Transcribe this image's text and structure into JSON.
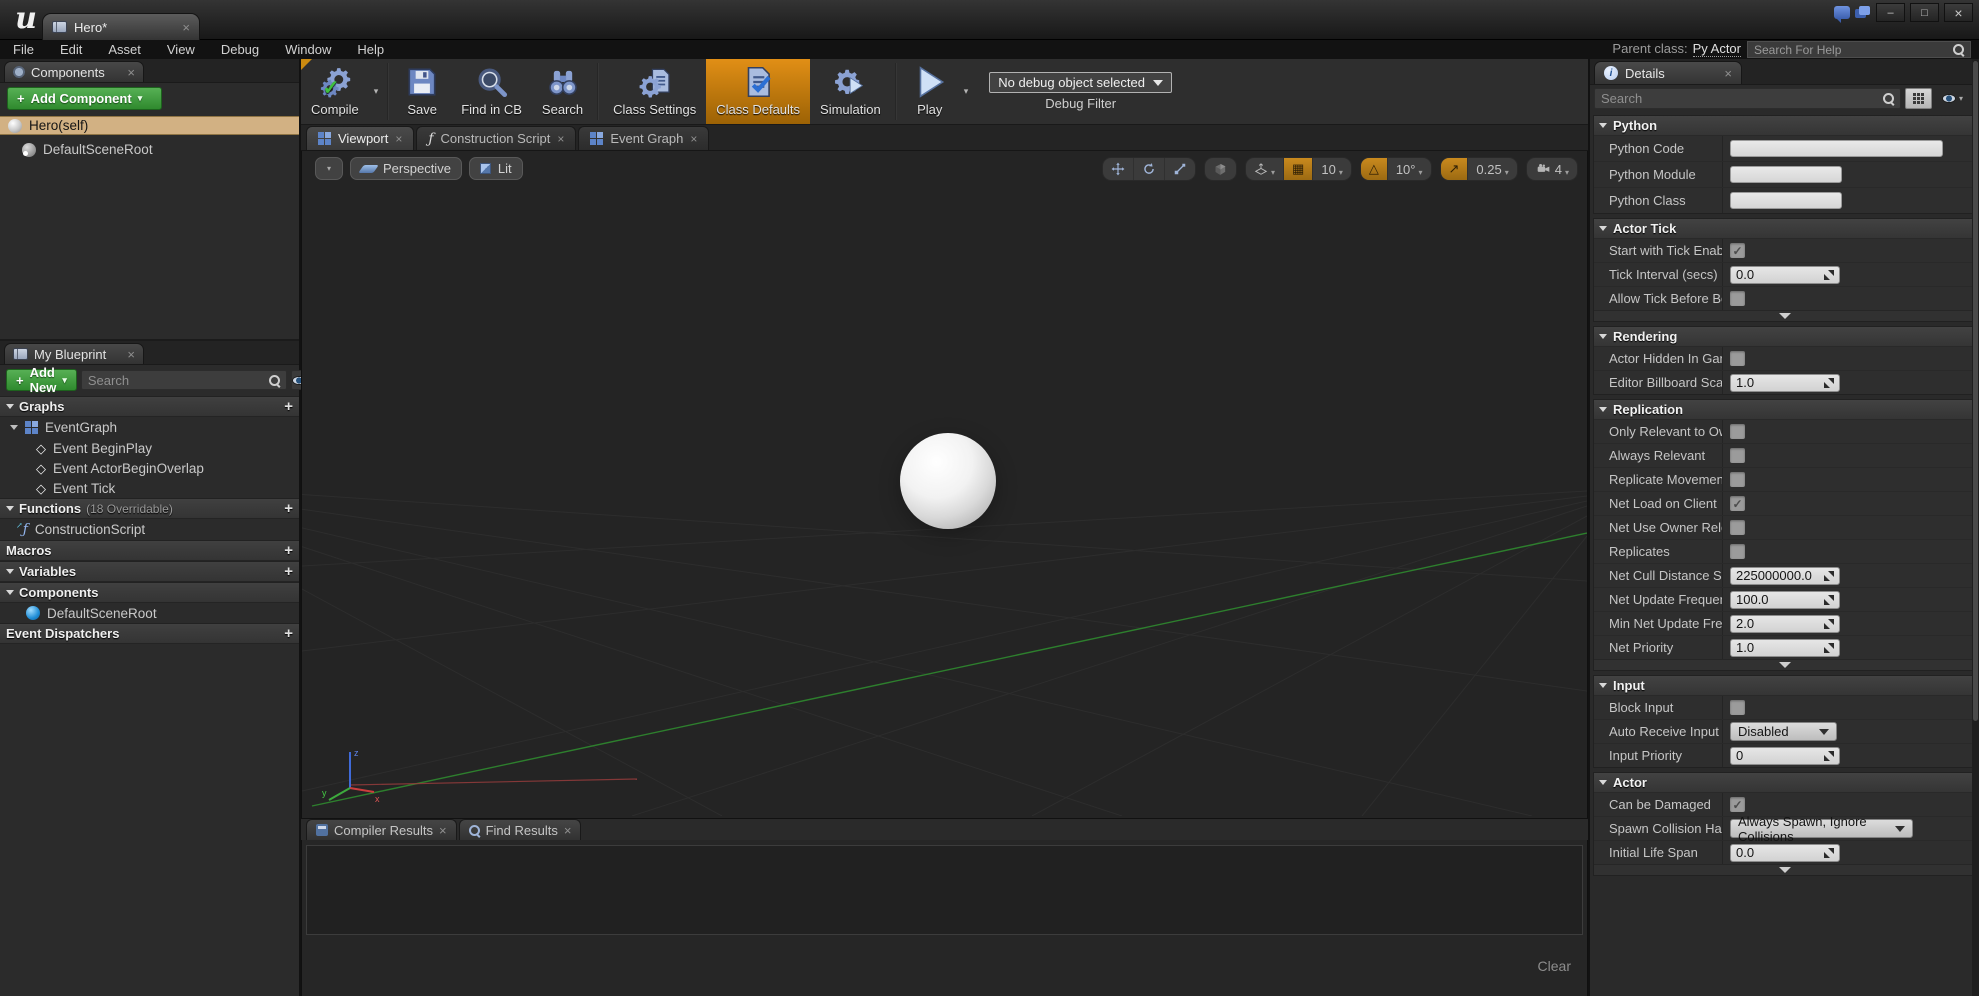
{
  "icons": {
    "plus": "+",
    "close": "×",
    "caret": "▾",
    "check": "✓",
    "minimize": "–",
    "maximize": "□",
    "close_window": "×",
    "diamond": "◇",
    "fn": "ƒ",
    "fn_arrow": "↗",
    "grid": "▦",
    "angle": "△",
    "diag_arrow": "↗",
    "rotate": "↻",
    "info": "i",
    "logo": "u"
  },
  "window": {
    "asset_tab": "Hero*",
    "menus": [
      "File",
      "Edit",
      "Asset",
      "View",
      "Debug",
      "Window",
      "Help"
    ],
    "parent_class_label": "Parent class:",
    "parent_class_value": "Py Actor",
    "help_search_placeholder": "Search For Help"
  },
  "toolbar": {
    "compile": "Compile",
    "save": "Save",
    "find_in_cb": "Find in CB",
    "search": "Search",
    "class_settings": "Class Settings",
    "class_defaults": "Class Defaults",
    "simulation": "Simulation",
    "play": "Play",
    "debug_object": "No debug object selected",
    "debug_filter": "Debug Filter"
  },
  "components": {
    "tab": "Components",
    "add_button": "Add Component",
    "root_item": "Hero(self)",
    "child_item": "DefaultSceneRoot"
  },
  "my_blueprint": {
    "tab": "My Blueprint",
    "add_new": "Add New",
    "search_placeholder": "Search",
    "graphs": "Graphs",
    "event_graph": "EventGraph",
    "events": [
      "Event BeginPlay",
      "Event ActorBeginOverlap",
      "Event Tick"
    ],
    "functions": "Functions",
    "functions_note": "(18 Overridable)",
    "construction_script": "ConstructionScript",
    "macros": "Macros",
    "variables": "Variables",
    "components_section": "Components",
    "scene_root": "DefaultSceneRoot",
    "event_dispatchers": "Event Dispatchers"
  },
  "viewport": {
    "tabs": [
      "Viewport",
      "Construction Script",
      "Event Graph"
    ],
    "perspective": "Perspective",
    "lit": "Lit",
    "grid_snap_value": "10",
    "rotation_snap_value": "10°",
    "scale_snap_value": "0.25",
    "camera_speed_value": "4"
  },
  "output": {
    "tabs": [
      "Compiler Results",
      "Find Results"
    ],
    "clear_button": "Clear"
  },
  "details": {
    "tab": "Details",
    "search_placeholder": "Search",
    "python": {
      "title": "Python",
      "code": "Python Code",
      "module": "Python Module",
      "cls": "Python Class"
    },
    "actor_tick": {
      "title": "Actor Tick",
      "start": "Start with Tick Enable",
      "start_checked": true,
      "interval": "Tick Interval (secs)",
      "interval_value": "0.0",
      "allow": "Allow Tick Before Beg"
    },
    "rendering": {
      "title": "Rendering",
      "hidden": "Actor Hidden In Game",
      "billboard": "Editor Billboard Scale",
      "billboard_value": "1.0"
    },
    "replication": {
      "title": "Replication",
      "only_relevant": "Only Relevant to Own",
      "always_relevant": "Always Relevant",
      "replicate_movement": "Replicate Movement",
      "net_load": "Net Load on Client",
      "net_load_checked": true,
      "net_use_owner": "Net Use Owner Releva",
      "replicates": "Replicates",
      "net_cull": "Net Cull Distance Squ",
      "net_cull_value": "225000000.0",
      "net_update": "Net Update Frequency",
      "net_update_value": "100.0",
      "min_net_update": "Min Net Update Frequ",
      "min_net_update_value": "2.0",
      "net_priority": "Net Priority",
      "net_priority_value": "1.0"
    },
    "input": {
      "title": "Input",
      "block": "Block Input",
      "auto_receive": "Auto Receive Input",
      "auto_receive_value": "Disabled",
      "priority": "Input Priority",
      "priority_value": "0"
    },
    "actor": {
      "title": "Actor",
      "can_damage": "Can be Damaged",
      "can_damage_checked": true,
      "spawn": "Spawn Collision Hand",
      "spawn_value": "Always Spawn, Ignore Collisions",
      "life_span": "Initial Life Span",
      "life_span_value": "0.0"
    }
  }
}
